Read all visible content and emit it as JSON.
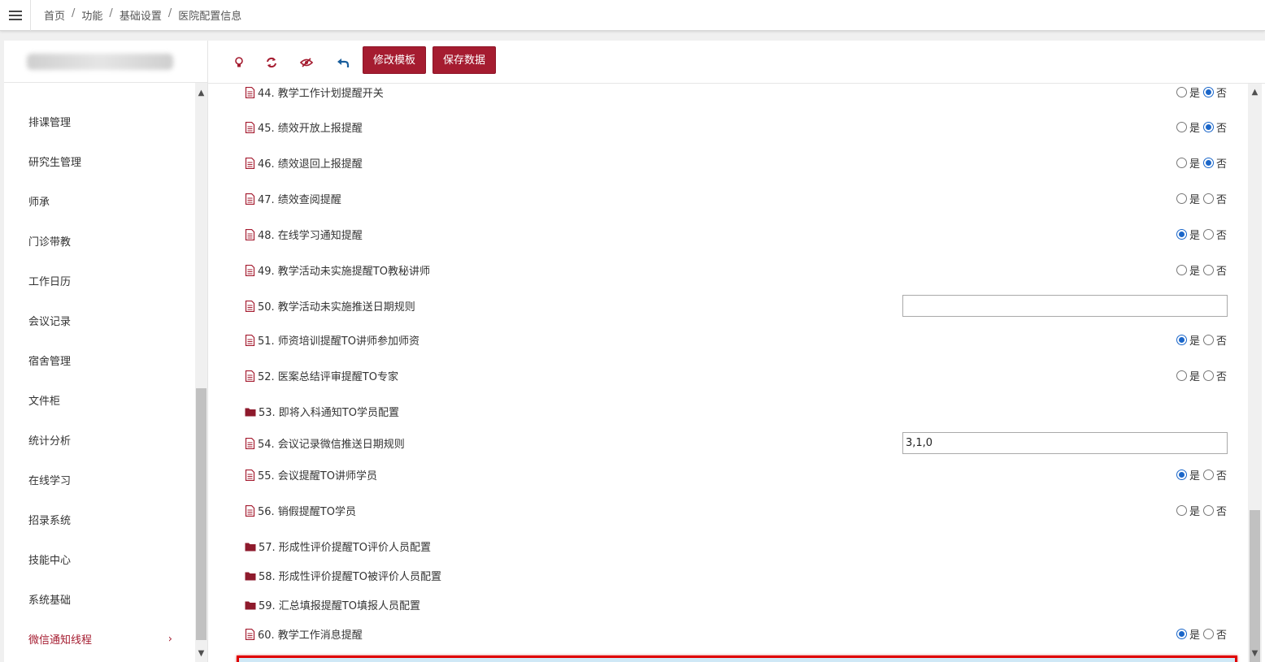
{
  "breadcrumb": [
    "首页",
    "功能",
    "基础设置",
    "医院配置信息"
  ],
  "sidebar": {
    "items": [
      {
        "label": "排课管理"
      },
      {
        "label": "研究生管理"
      },
      {
        "label": "师承"
      },
      {
        "label": "门诊带教"
      },
      {
        "label": "工作日历"
      },
      {
        "label": "会议记录"
      },
      {
        "label": "宿舍管理"
      },
      {
        "label": "文件柜"
      },
      {
        "label": "统计分析"
      },
      {
        "label": "在线学习"
      },
      {
        "label": "招录系统"
      },
      {
        "label": "技能中心"
      },
      {
        "label": "系统基础"
      },
      {
        "label": "微信通知线程",
        "active": true
      }
    ],
    "active_chevron": "›"
  },
  "toolbar": {
    "edit_template_label": "修改模板",
    "save_data_label": "保存数据"
  },
  "radio_labels": {
    "yes": "是",
    "no": "否"
  },
  "rows": [
    {
      "label": "44. 教学工作计划提醒开关",
      "type": "radio",
      "value": "否",
      "icon": "file-icon",
      "partial": true
    },
    {
      "label": "45. 绩效开放上报提醒",
      "type": "radio",
      "value": "否",
      "icon": "file-icon"
    },
    {
      "label": "46. 绩效退回上报提醒",
      "type": "radio",
      "value": "否",
      "icon": "file-icon"
    },
    {
      "label": "47. 绩效查阅提醒",
      "type": "radio",
      "value": "",
      "icon": "file-icon"
    },
    {
      "label": "48. 在线学习通知提醒",
      "type": "radio",
      "value": "是",
      "icon": "file-icon"
    },
    {
      "label": "49. 教学活动未实施提醒TO教秘讲师",
      "type": "radio",
      "value": "",
      "icon": "file-icon"
    },
    {
      "label": "50. 教学活动未实施推送日期规则",
      "type": "input",
      "value": "",
      "icon": "file-icon"
    },
    {
      "label": "51. 师资培训提醒TO讲师参加师资",
      "type": "radio",
      "value": "是",
      "icon": "file-icon"
    },
    {
      "label": "52. 医案总结评审提醒TO专家",
      "type": "radio",
      "value": "",
      "icon": "file-icon"
    },
    {
      "label": "53. 即将入科通知TO学员配置",
      "type": "folder",
      "value": "",
      "icon": "folder-icon"
    },
    {
      "label": "54. 会议记录微信推送日期规则",
      "type": "input",
      "value": "3,1,0",
      "icon": "file-icon"
    },
    {
      "label": "55. 会议提醒TO讲师学员",
      "type": "radio",
      "value": "是",
      "icon": "file-icon"
    },
    {
      "label": "56. 销假提醒TO学员",
      "type": "radio",
      "value": "",
      "icon": "file-icon"
    },
    {
      "label": "57. 形成性评价提醒TO评价人员配置",
      "type": "folder",
      "value": "",
      "icon": "folder-icon"
    },
    {
      "label": "58. 形成性评价提醒TO被评价人员配置",
      "type": "folder",
      "value": "",
      "icon": "folder-icon"
    },
    {
      "label": "59. 汇总填报提醒TO填报人员配置",
      "type": "folder",
      "value": "",
      "icon": "folder-icon"
    },
    {
      "label": "60. 教学工作消息提醒",
      "type": "radio",
      "value": "是",
      "icon": "file-icon",
      "highlighted": true
    }
  ],
  "colors": {
    "accent": "#a51c30",
    "radio_checked": "#1a66c9",
    "highlight_border": "#e00000",
    "highlight_bg": "#cfe8f6"
  }
}
